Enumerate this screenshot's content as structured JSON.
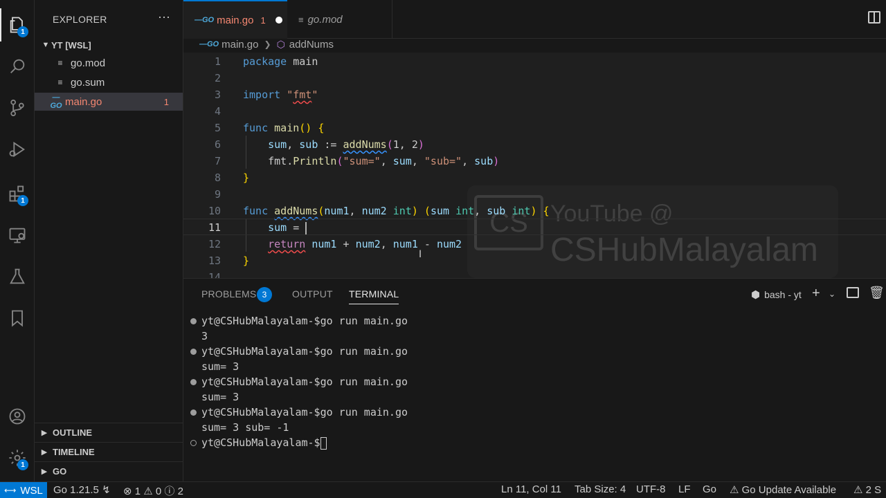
{
  "sidebar": {
    "title": "EXPLORER",
    "more": "···",
    "root": "YT [WSL]",
    "files": [
      {
        "name": "go.mod",
        "icon": "lines-icon"
      },
      {
        "name": "go.sum",
        "icon": "lines-icon"
      },
      {
        "name": "main.go",
        "icon": "go-icon",
        "errors": "1"
      }
    ],
    "sections": [
      "OUTLINE",
      "TIMELINE",
      "GO"
    ]
  },
  "activity": {
    "explorer_badge": "1",
    "extensions_badge": "1",
    "settings_badge": "1"
  },
  "tabs": [
    {
      "label": "main.go",
      "count": "1",
      "go_logo": "GO"
    },
    {
      "label": "go.mod"
    }
  ],
  "breadcrumb": {
    "file": "main.go",
    "symbol": "addNums",
    "go_logo": "GO"
  },
  "editor": {
    "line_numbers": [
      "1",
      "2",
      "3",
      "4",
      "5",
      "6",
      "7",
      "8",
      "9",
      "10",
      "11",
      "12",
      "13",
      "14"
    ],
    "watermark_line1": "YouTube @",
    "watermark_line2": "CSHubMalayalam",
    "watermark_logo": "CS"
  },
  "panel": {
    "tabs": [
      "PROBLEMS",
      "OUTPUT",
      "TERMINAL"
    ],
    "problems_count": "3",
    "terminal_name": "bash - yt",
    "terminal_lines": [
      {
        "text": "yt@CSHubMalayalam-$go run main.go",
        "dot": "filled"
      },
      {
        "text": "3",
        "dot": ""
      },
      {
        "text": "yt@CSHubMalayalam-$go run main.go",
        "dot": "filled"
      },
      {
        "text": "sum= 3",
        "dot": ""
      },
      {
        "text": "yt@CSHubMalayalam-$go run main.go",
        "dot": "filled"
      },
      {
        "text": "sum= 3",
        "dot": ""
      },
      {
        "text": "yt@CSHubMalayalam-$go run main.go",
        "dot": "filled"
      },
      {
        "text": "sum= 3 sub= -1",
        "dot": ""
      },
      {
        "text": "yt@CSHubMalayalam-$",
        "dot": "hollow"
      }
    ]
  },
  "status": {
    "remote": "WSL",
    "go_version": "Go 1.21.5",
    "errors": "1",
    "warnings": "0",
    "infos": "2",
    "position": "Ln 11, Col 11",
    "tab_size": "Tab Size: 4",
    "encoding": "UTF-8",
    "eol": "LF",
    "language": "Go",
    "update": "Go Update Available",
    "problems": "2 S"
  },
  "colors": {
    "accent": "#0078d4",
    "error": "#f48771",
    "keyword": "#569cd6",
    "function": "#dcdcaa",
    "string": "#ce9178",
    "type": "#4ec9b0"
  }
}
